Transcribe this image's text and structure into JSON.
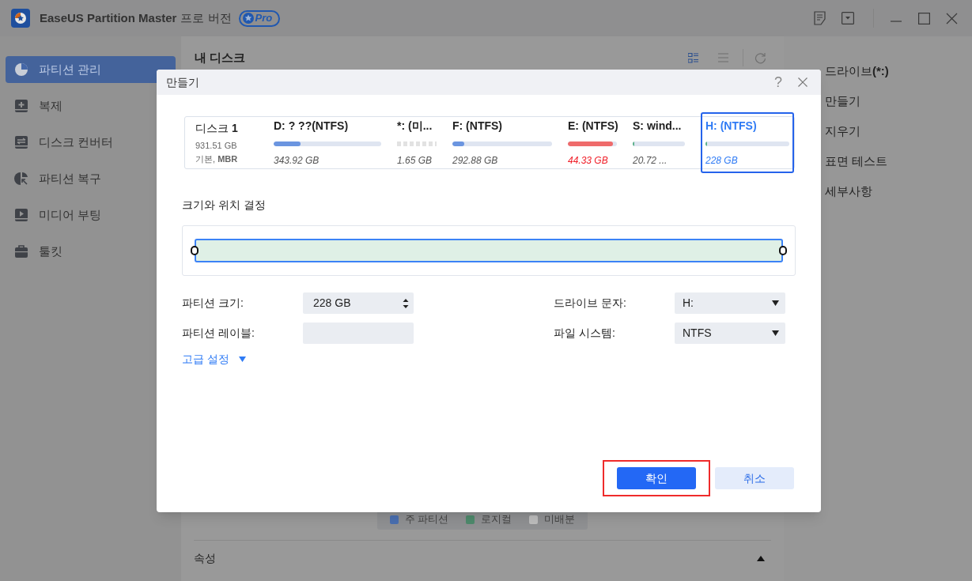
{
  "app": {
    "title": "EaseUS Partition Master",
    "edition": "프로 버전",
    "badge": "Pro"
  },
  "sidebar": {
    "items": [
      {
        "label": "파티션 관리",
        "selected": true
      },
      {
        "label": "복제",
        "selected": false
      },
      {
        "label": "디스크 컨버터",
        "selected": false
      },
      {
        "label": "파티션 복구",
        "selected": false
      },
      {
        "label": "미디어 부팅",
        "selected": false
      },
      {
        "label": "툴킷",
        "selected": false
      }
    ]
  },
  "main": {
    "title": "내 디스크",
    "legend": [
      {
        "label": "주 파티션",
        "color": "#4a6fb0"
      },
      {
        "label": "로지컬",
        "color": "#4e8a6c"
      },
      {
        "label": "미배분",
        "color": "#bdbdbd"
      }
    ],
    "properties": {
      "label": "속성",
      "expanded": true
    }
  },
  "right_panel": {
    "items": [
      {
        "label": "드라이브",
        "bold_suffix": "(*:)"
      },
      {
        "label": "만들기"
      },
      {
        "label": "지우기"
      },
      {
        "label": "표면 테스트"
      },
      {
        "label": "세부사항"
      }
    ]
  },
  "dialog": {
    "title": "만들기",
    "help": "?",
    "slider": {
      "level": 1
    },
    "disk": {
      "name": "디스크",
      "number": "1",
      "size": "931.51 GB",
      "type": "기본,",
      "style": "MBR"
    },
    "partitions": [
      {
        "label": "D: ? ??(NTFS)",
        "size": "343.92 GB",
        "level": 0.25,
        "kind": "used",
        "color": "#6b95e0",
        "selected": false,
        "warning": false
      },
      {
        "label": "*: (미...",
        "size": "1.65 GB",
        "kind": "unallocated",
        "selected": false,
        "warning": false
      },
      {
        "label": "F: (NTFS)",
        "size": "292.88 GB",
        "level": 0.12,
        "kind": "used",
        "color": "#6b95e0",
        "selected": false,
        "warning": false
      },
      {
        "label": "E: (NTFS)",
        "size": "44.33 GB",
        "level": 0.92,
        "kind": "used",
        "color": "#ef6b6b",
        "selected": false,
        "warning": true
      },
      {
        "label": "S: wind...",
        "size": "20.72 ...",
        "level": 0.03,
        "kind": "used",
        "color": "#5bb08a",
        "selected": false,
        "warning": false
      },
      {
        "label": "H: (NTFS)",
        "size": "228 GB",
        "level": 0.01,
        "kind": "used",
        "color": "#5bb08a",
        "selected": true,
        "warning": false
      }
    ],
    "section": "크기와 위치 결정",
    "fields": [
      {
        "label": "파티션 크기:",
        "value": "228 GB",
        "kind": "spin"
      },
      {
        "label": "드라이브 문자:",
        "value": "H:",
        "kind": "select"
      },
      {
        "label": "파티션 레이블:",
        "kind": "text"
      },
      {
        "label": "파일 시스템:",
        "value": "NTFS",
        "kind": "select"
      }
    ],
    "advanced": {
      "label": "고급 설정",
      "expanded": false
    },
    "buttons": [
      {
        "label": "확인",
        "kind": "primary",
        "highlighted": true
      },
      {
        "label": "취소",
        "kind": "secondary",
        "highlighted": false
      }
    ]
  }
}
